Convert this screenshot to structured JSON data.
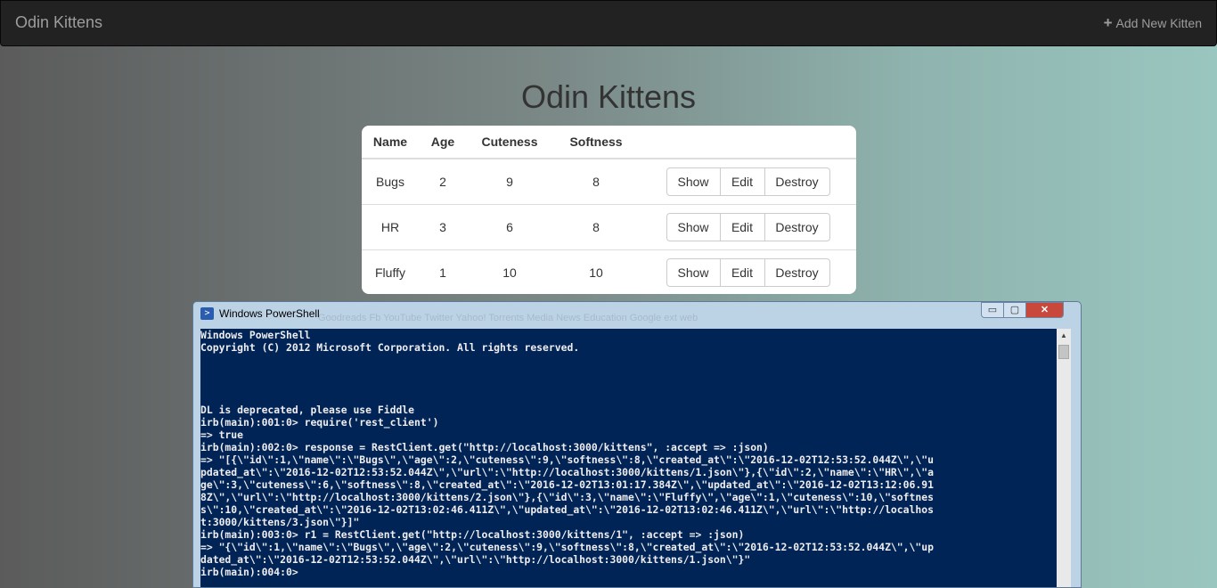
{
  "navbar": {
    "brand": "Odin Kittens",
    "add_link": "Add New Kitten",
    "add_icon": "plus-icon"
  },
  "page": {
    "title": "Odin Kittens"
  },
  "table": {
    "headers": [
      "Name",
      "Age",
      "Cuteness",
      "Softness"
    ],
    "rows": [
      {
        "name": "Bugs",
        "age": "2",
        "cuteness": "9",
        "softness": "8"
      },
      {
        "name": "HR",
        "age": "3",
        "cuteness": "6",
        "softness": "8"
      },
      {
        "name": "Fluffy",
        "age": "1",
        "cuteness": "10",
        "softness": "10"
      }
    ],
    "actions": {
      "show": "Show",
      "edit": "Edit",
      "destroy": "Destroy"
    }
  },
  "powershell": {
    "title": "Windows PowerShell",
    "ghost_bookmarks": "Goodreads   Fb   YouTube   Twitter   Yahoo!   Torrents   Media News   Education   Google   ext web",
    "minimize": "▭",
    "maximize": "▢",
    "close": "✕",
    "console_lines": [
      "Windows PowerShell",
      "Copyright (C) 2012 Microsoft Corporation. All rights reserved.",
      "",
      "",
      "",
      "",
      "DL is deprecated, please use Fiddle",
      "irb(main):001:0> require('rest_client')",
      "=> true",
      "irb(main):002:0> response = RestClient.get(\"http://localhost:3000/kittens\", :accept => :json)",
      "=> \"[{\\\"id\\\":1,\\\"name\\\":\\\"Bugs\\\",\\\"age\\\":2,\\\"cuteness\\\":9,\\\"softness\\\":8,\\\"created_at\\\":\\\"2016-12-02T12:53:52.044Z\\\",\\\"u",
      "pdated_at\\\":\\\"2016-12-02T12:53:52.044Z\\\",\\\"url\\\":\\\"http://localhost:3000/kittens/1.json\\\"},{\\\"id\\\":2,\\\"name\\\":\\\"HR\\\",\\\"a",
      "ge\\\":3,\\\"cuteness\\\":6,\\\"softness\\\":8,\\\"created_at\\\":\\\"2016-12-02T13:01:17.384Z\\\",\\\"updated_at\\\":\\\"2016-12-02T13:12:06.91",
      "8Z\\\",\\\"url\\\":\\\"http://localhost:3000/kittens/2.json\\\"},{\\\"id\\\":3,\\\"name\\\":\\\"Fluffy\\\",\\\"age\\\":1,\\\"cuteness\\\":10,\\\"softnes",
      "s\\\":10,\\\"created_at\\\":\\\"2016-12-02T13:02:46.411Z\\\",\\\"updated_at\\\":\\\"2016-12-02T13:02:46.411Z\\\",\\\"url\\\":\\\"http://localhos",
      "t:3000/kittens/3.json\\\"}]\"",
      "irb(main):003:0> r1 = RestClient.get(\"http://localhost:3000/kittens/1\", :accept => :json)",
      "=> \"{\\\"id\\\":1,\\\"name\\\":\\\"Bugs\\\",\\\"age\\\":2,\\\"cuteness\\\":9,\\\"softness\\\":8,\\\"created_at\\\":\\\"2016-12-02T12:53:52.044Z\\\",\\\"up",
      "dated_at\\\":\\\"2016-12-02T12:53:52.044Z\\\",\\\"url\\\":\\\"http://localhost:3000/kittens/1.json\\\"}\"",
      "irb(main):004:0>"
    ]
  }
}
